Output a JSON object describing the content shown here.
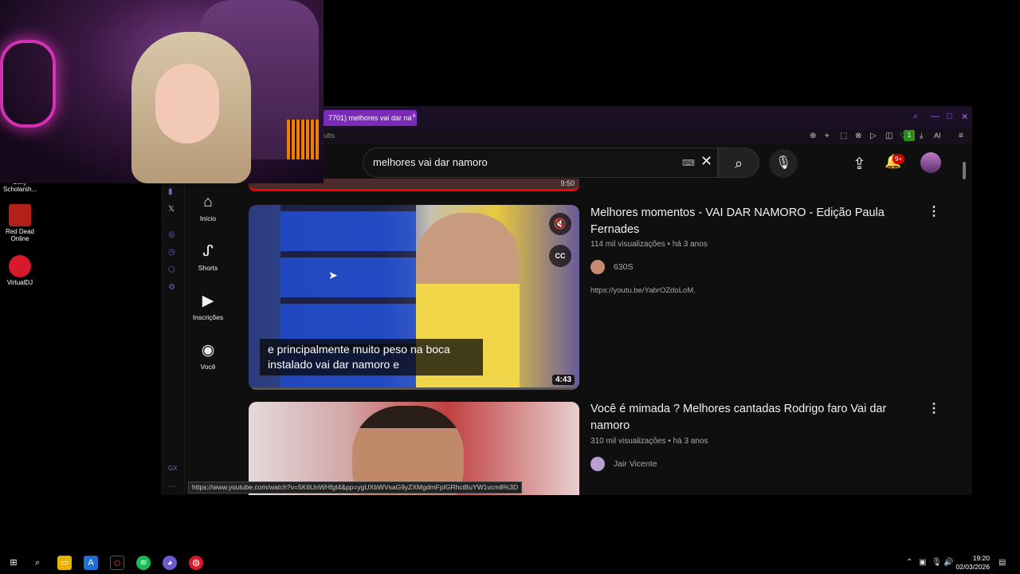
{
  "desktop": {
    "icons": [
      {
        "label": "Bully Scholarsh...",
        "color": "#555555"
      },
      {
        "label": "Red Dead Online",
        "color": "#b2201a"
      },
      {
        "label": "VirtualDJ",
        "color": "#d61a2c"
      }
    ]
  },
  "browser": {
    "tab_title": "7701) melhores vai dar na",
    "new_tab": "+",
    "address_text": "ults",
    "extension_badge": "1",
    "ai_label": "AI",
    "status_url": "https://www.youtube.com/watch?v=5K6UnWHfgt4&pp=ygUXbWVsaG9yZXMgdmFpIGRhciBuYW1vcm8%3D"
  },
  "youtube": {
    "search_value": "melhores vai dar namoro",
    "notification_count": "9+",
    "guide": [
      {
        "label": "Início",
        "icon": "home-icon",
        "glyph": "⌂"
      },
      {
        "label": "Shorts",
        "icon": "shorts-icon",
        "glyph": "ᔑ"
      },
      {
        "label": "Inscrições",
        "icon": "subscriptions-icon",
        "glyph": "▶"
      },
      {
        "label": "Você",
        "icon": "you-icon",
        "glyph": "◉"
      }
    ],
    "prev_duration": "9:50",
    "videos": [
      {
        "title": "Melhores momentos - VAI DAR NAMORO - Edição Paula Fernades",
        "views": "114 mil visualizações",
        "age": "há 3 anos",
        "channel": "630S",
        "description": "https://youtu.be/YabrOZdoLoM.",
        "duration": "4:43",
        "caption": "e principalmente muito peso na boca instalado vai dar namoro e",
        "cc_label": "CC"
      },
      {
        "title": "Você é mimada ? Melhores cantadas Rodrigo faro Vai dar namoro",
        "views": "310 mil visualizações",
        "age": "há 3 anos",
        "channel": "Jair Vicente"
      }
    ]
  },
  "taskbar": {
    "time": "19:20",
    "date": "02/03/2026"
  }
}
